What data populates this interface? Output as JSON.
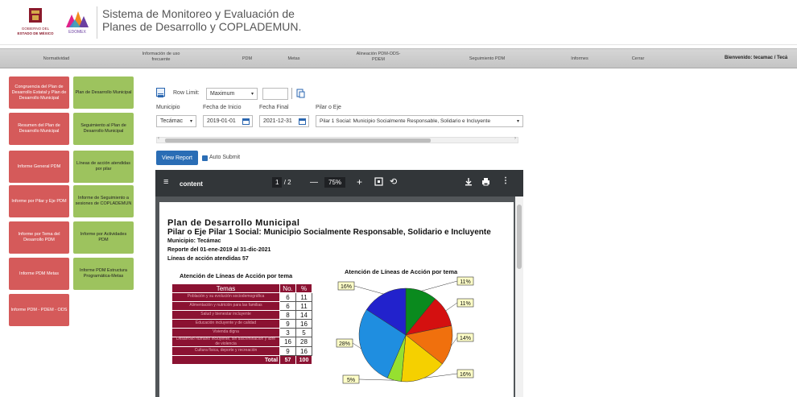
{
  "header": {
    "logo1_text": "GOBIERNO DEL ESTADO DE MÉXICO",
    "logo2_text": "EDOMEX",
    "title": "Sistema de Monitoreo y Evaluación de Planes de Desarrollo y COPLADEMUN."
  },
  "nav": {
    "items": [
      {
        "label": "Normatividad"
      },
      {
        "label": "Información de uso frecuente"
      },
      {
        "label": "PDM"
      },
      {
        "label": "Metas"
      },
      {
        "label": "Alineación PDM-ODS-PDEM"
      },
      {
        "label": "Seguimiento PDM"
      },
      {
        "label": "Informes"
      },
      {
        "label": "Cerrar"
      }
    ],
    "welcome": "Bienvenido: tecamac / Tecá"
  },
  "tiles": {
    "left": [
      "Congruencia del Plan de Desarrollo Estatal y Plan de Desarrollo Municipal",
      "Resumen del Plan de Desarrollo Municipal",
      "Informe General PDM",
      "Informe por Pilar y Eje PDM",
      "Informe por Tema del Desarrollo PDM",
      "Informe PDM Metas",
      "Informe PDM - PDEM - ODS"
    ],
    "right": [
      "Plan de Desarrollo Municipal",
      "Seguimiento al Plan de Desarrollo Municipal",
      "Líneas de acción atendidas por pilar",
      "Informe de Seguimiento a sesiones de COPLADEMUN",
      "Informe por Actividades PDM",
      "Informe PDM Estructura Programática-Metas"
    ]
  },
  "report_controls": {
    "row_limit_label": "Row Limit:",
    "row_limit_value": "Maximum",
    "municipio_label": "Municipio",
    "municipio_value": "Tecámac",
    "fecha_inicio_label": "Fecha de Inicio",
    "fecha_inicio_value": "2019-01-01",
    "fecha_final_label": "Fecha Final",
    "fecha_final_value": "2021-12-31",
    "pilar_label": "Pilar o Eje",
    "pilar_value": "Pilar 1 Social: Municipio Socialmente Responsable, Solidario e Incluyente",
    "view_report": "View Report",
    "auto_submit": "Auto Submit"
  },
  "pdf": {
    "title": "content",
    "page_current": "1",
    "page_total": "/ 2",
    "zoom": "75%"
  },
  "report": {
    "h1": "Plan de Desarrollo Municipal",
    "h2": "Pilar o Eje  Pilar 1 Social: Municipio Socialmente Responsable, Solidario e Incluyente",
    "municipio": "Municipio:  Tecámac",
    "periodo": "Reporte del 01-ene-2019  al 31-dic-2021",
    "lineas": "Líneas de acción atendidas    57",
    "table_title": "Atención de Líneas de Acción por tema",
    "col_temas": "Temas",
    "col_no": "No.",
    "col_pct": "%",
    "rows": [
      {
        "tema": "Población y su evolución sociodemográfica",
        "no": "6",
        "pct": "11"
      },
      {
        "tema": "Alimentación y nutrición para las familias",
        "no": "6",
        "pct": "11"
      },
      {
        "tema": "Salud y bienestar incluyente",
        "no": "8",
        "pct": "14"
      },
      {
        "tema": "Educación incluyente y de calidad",
        "no": "9",
        "pct": "16"
      },
      {
        "tema": "Vivienda digna",
        "no": "3",
        "pct": "5"
      },
      {
        "tema": "Desarrollo humano incluyente, sin discriminación y libre de violencia",
        "no": "16",
        "pct": "28"
      },
      {
        "tema": "Cultura física, deporte y recreación",
        "no": "9",
        "pct": "16"
      }
    ],
    "total_label": "Total",
    "total_no": "57",
    "total_pct": "100"
  },
  "chart_data": {
    "type": "pie",
    "title": "Atención de Líneas de Acción por tema",
    "labels": [
      "11%",
      "11%",
      "14%",
      "16%",
      "5%",
      "28%",
      "16%"
    ],
    "values": [
      11,
      11,
      14,
      16,
      5,
      28,
      16
    ],
    "colors": [
      "#0a8a1e",
      "#d41010",
      "#f0700d",
      "#f5d000",
      "#96e030",
      "#1f8ee0",
      "#2222cc"
    ]
  }
}
